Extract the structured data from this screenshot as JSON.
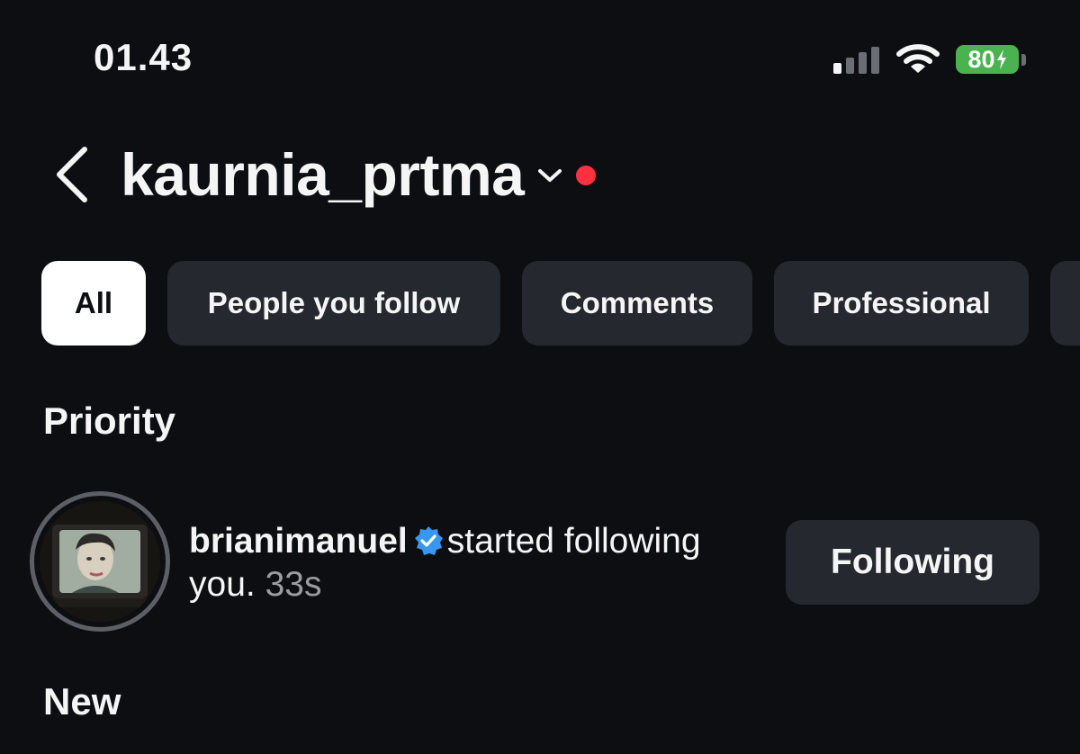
{
  "status_bar": {
    "time": "01.43",
    "battery_level": "80",
    "signal_bars_active": 1,
    "signal_bars_total": 4
  },
  "header": {
    "username": "kaurnia_prtma",
    "has_unread_dot": true
  },
  "filters": [
    {
      "label": "All",
      "active": true
    },
    {
      "label": "People you follow",
      "active": false
    },
    {
      "label": "Comments",
      "active": false
    },
    {
      "label": "Professional",
      "active": false
    },
    {
      "label": "",
      "active": false
    }
  ],
  "sections": {
    "priority": "Priority",
    "new": "New"
  },
  "notification": {
    "username": "brianimanuel",
    "verified": true,
    "action": "started following you.",
    "time": "33s",
    "button_label": "Following"
  },
  "colors": {
    "background": "#0c0e12",
    "chip": "#25282e",
    "notif_dot": "#ff3040",
    "verified": "#3897f0",
    "battery": "#4ab34f"
  }
}
